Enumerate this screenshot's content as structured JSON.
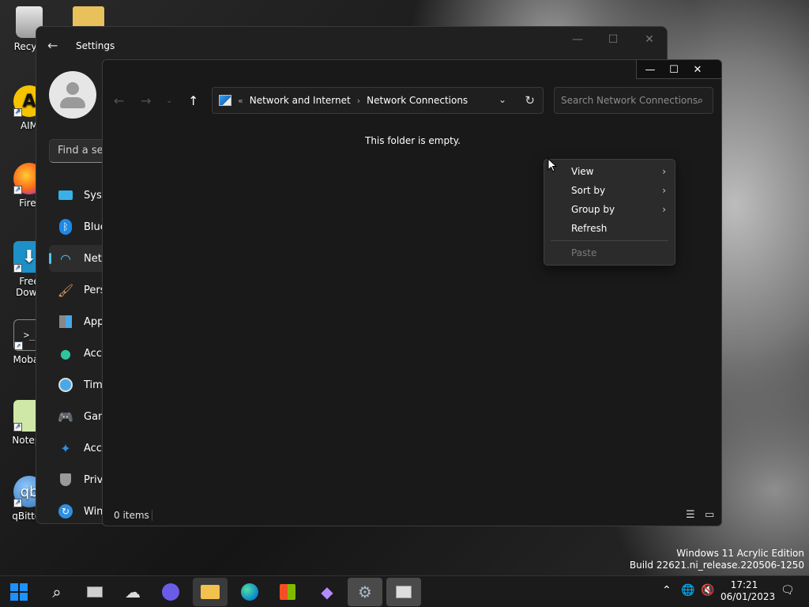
{
  "desktop": {
    "icons": [
      {
        "label": "Recycl",
        "glyph": "🗑"
      },
      {
        "label": "AIM",
        "glyph": "A"
      },
      {
        "label": "Firef",
        "glyph": "🦊"
      },
      {
        "label": "Free Down",
        "glyph": "⬇"
      },
      {
        "label": "MobaX",
        "glyph": ">_"
      },
      {
        "label": "Notepa",
        "glyph": "📝"
      },
      {
        "label": "qBitton",
        "glyph": "qb"
      }
    ]
  },
  "settings": {
    "title": "Settings",
    "search_placeholder": "Find a set",
    "nav_items": [
      {
        "label": "Syst",
        "icon": "monitor-icon"
      },
      {
        "label": "Blue",
        "icon": "bluetooth-icon"
      },
      {
        "label": "Netw",
        "icon": "wifi-icon"
      },
      {
        "label": "Pers",
        "icon": "brush-icon"
      },
      {
        "label": "App",
        "icon": "apps-icon"
      },
      {
        "label": "Acco",
        "icon": "person-icon"
      },
      {
        "label": "Time",
        "icon": "clock-icon"
      },
      {
        "label": "Gam",
        "icon": "gamepad-icon"
      },
      {
        "label": "Acce",
        "icon": "accessibility-icon"
      },
      {
        "label": "Priva",
        "icon": "shield-icon"
      },
      {
        "label": "Win",
        "icon": "update-icon"
      }
    ]
  },
  "explorer": {
    "breadcrumb": {
      "prefix": "«",
      "items": [
        "Network and Internet",
        "Network Connections"
      ]
    },
    "search_placeholder": "Search Network Connections",
    "empty_message": "This folder is empty.",
    "status": {
      "item_count": "0 items"
    }
  },
  "context_menu": {
    "items": [
      {
        "label": "View",
        "submenu": true
      },
      {
        "label": "Sort by",
        "submenu": true
      },
      {
        "label": "Group by",
        "submenu": true
      },
      {
        "label": "Refresh",
        "submenu": false
      },
      {
        "label": "Paste",
        "submenu": false,
        "disabled": true
      }
    ]
  },
  "watermark": {
    "line1": "Windows 11 Acrylic Edition",
    "line2": "Build 22621.ni_release.220506-1250"
  },
  "taskbar": {
    "time": "17:21",
    "date": "06/01/2023"
  },
  "colors": {
    "accent": "#4cc2ff",
    "window_bg": "#191919",
    "menu_bg": "#2b2b2b"
  }
}
